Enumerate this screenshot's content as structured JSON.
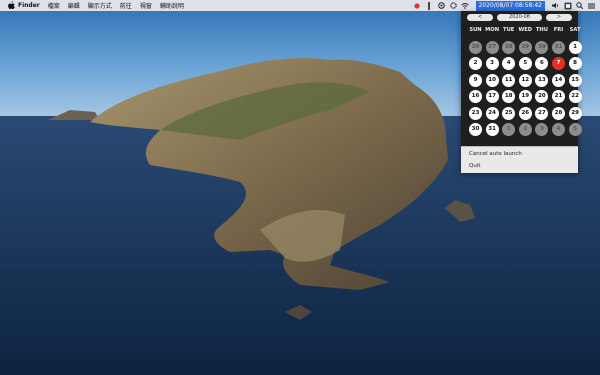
{
  "menubar": {
    "app": "Finder",
    "items": [
      "檔案",
      "編輯",
      "顯示方式",
      "前往",
      "視窗",
      "輔助說明"
    ],
    "clock": "2020/08/07 08:58:42"
  },
  "calendar": {
    "prev": "<",
    "next": ">",
    "month": "2020-08",
    "weekdays": [
      "SUN",
      "MON",
      "TUE",
      "WED",
      "THU",
      "FRI",
      "SAT"
    ],
    "weeks": [
      [
        "26",
        "27",
        "28",
        "29",
        "30",
        "31",
        "1"
      ],
      [
        "2",
        "3",
        "4",
        "5",
        "6",
        "7",
        "8"
      ],
      [
        "9",
        "10",
        "11",
        "12",
        "13",
        "14",
        "15"
      ],
      [
        "16",
        "17",
        "18",
        "19",
        "20",
        "21",
        "22"
      ],
      [
        "23",
        "24",
        "25",
        "26",
        "27",
        "28",
        "29"
      ],
      [
        "30",
        "31",
        "1",
        "2",
        "3",
        "4",
        "5"
      ]
    ],
    "today": "7"
  },
  "menu": {
    "cancel": "Cancel auto launch",
    "quit": "Quit"
  },
  "icons": [
    "apple-icon",
    "record-icon",
    "pin-icon",
    "spotlight-alt-icon",
    "gear-icon",
    "wifi-icon",
    "volume-icon",
    "keyboard-icon",
    "search-icon",
    "menu-icon"
  ]
}
